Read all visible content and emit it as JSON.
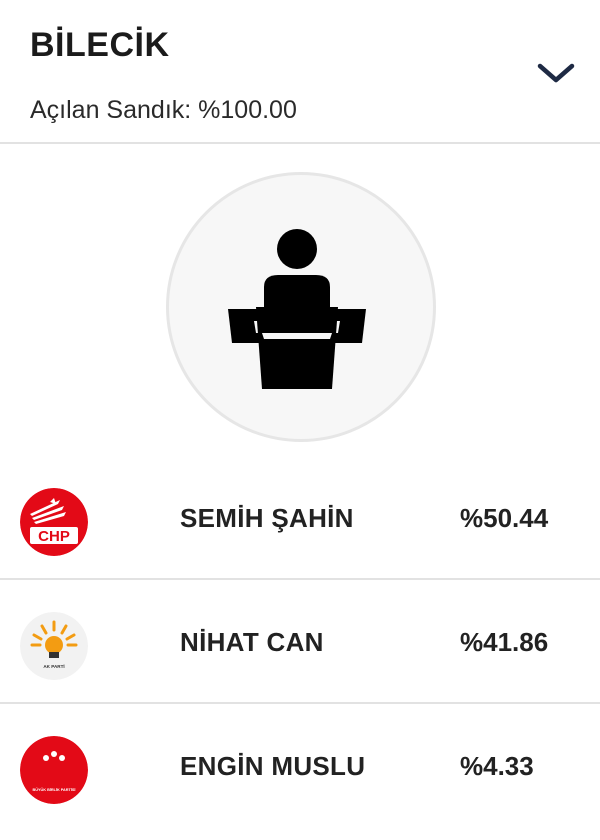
{
  "header": {
    "city": "BİLECİK",
    "opened_boxes": "Açılan Sandık: %100.00"
  },
  "candidates": [
    {
      "name": "SEMİH ŞAHİN",
      "percent": "%50.44",
      "party_logo": "chp-logo",
      "logo_text": "CHP",
      "logo_color": "#e30a17"
    },
    {
      "name": "NİHAT CAN",
      "percent": "%41.86",
      "party_logo": "ak-parti-logo",
      "logo_text": "AK PARTİ",
      "logo_color": "#f39c12"
    },
    {
      "name": "ENGİN MUSLU",
      "percent": "%4.33",
      "party_logo": "bbp-logo",
      "logo_text": "BÜYÜK BİRLİK PARTİSİ",
      "logo_color": "#e30a17"
    }
  ]
}
